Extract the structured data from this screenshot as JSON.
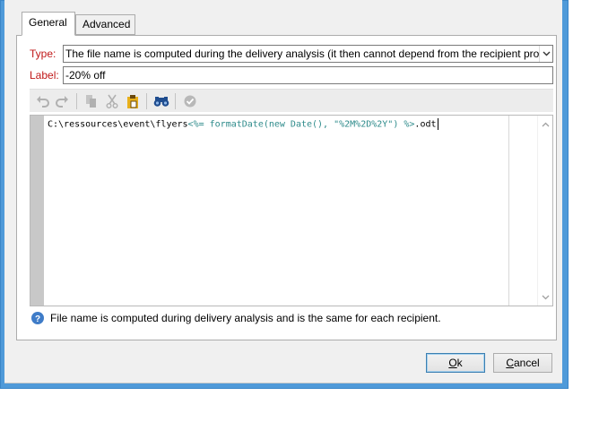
{
  "tabs": [
    {
      "label": "General",
      "active": true
    },
    {
      "label": "Advanced",
      "active": false
    }
  ],
  "type_field": {
    "label": "Type:",
    "value": "The file name is computed during the delivery analysis (it then cannot depend from the recipient pro"
  },
  "label_field": {
    "label": "Label:",
    "value": "-20% off"
  },
  "toolbar": {
    "icons": [
      "undo-icon",
      "redo-icon",
      "copy-icon",
      "cut-icon",
      "paste-icon",
      "find-icon",
      "check-icon"
    ]
  },
  "editor": {
    "plain_prefix": "C:\\ressources\\event\\flyers",
    "template_expr": "<%= formatDate(new Date(), \"%2M%2D%2Y\") %>",
    "plain_suffix": ".odt"
  },
  "info": {
    "text": "File name is computed during delivery analysis and is the same for each recipient."
  },
  "buttons": {
    "ok_mnemonic": "O",
    "ok_rest": "k",
    "cancel_mnemonic": "C",
    "cancel_rest": "ancel"
  },
  "colors": {
    "accent_frame": "#4f9ad9",
    "field_label": "#c01818",
    "template_code": "#2e8b8b",
    "find_icon": "#1f4d8f",
    "paste_icon": "#e8b01c"
  }
}
